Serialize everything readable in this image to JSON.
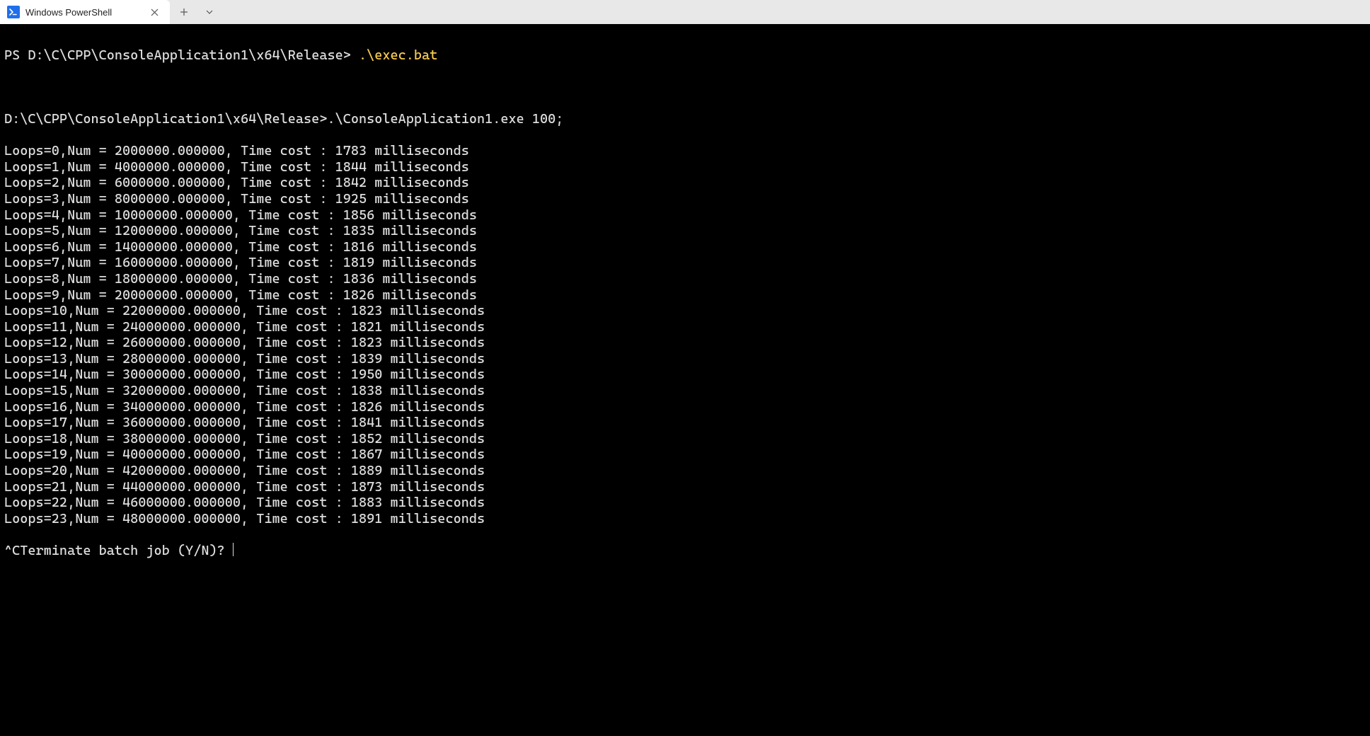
{
  "tab": {
    "title": "Windows PowerShell",
    "icon": "powershell-icon"
  },
  "prompt": {
    "prefix": "PS ",
    "path": "D:\\C\\CPP\\ConsoleApplication1\\x64\\Release>",
    "command": ".\\exec.bat"
  },
  "echo_line": "D:\\C\\CPP\\ConsoleApplication1\\x64\\Release>.\\ConsoleApplication1.exe 100;",
  "output_lines": [
    "Loops=0,Num = 2000000.000000, Time cost : 1783 milliseconds",
    "Loops=1,Num = 4000000.000000, Time cost : 1844 milliseconds",
    "Loops=2,Num = 6000000.000000, Time cost : 1842 milliseconds",
    "Loops=3,Num = 8000000.000000, Time cost : 1925 milliseconds",
    "Loops=4,Num = 10000000.000000, Time cost : 1856 milliseconds",
    "Loops=5,Num = 12000000.000000, Time cost : 1835 milliseconds",
    "Loops=6,Num = 14000000.000000, Time cost : 1816 milliseconds",
    "Loops=7,Num = 16000000.000000, Time cost : 1819 milliseconds",
    "Loops=8,Num = 18000000.000000, Time cost : 1836 milliseconds",
    "Loops=9,Num = 20000000.000000, Time cost : 1826 milliseconds",
    "Loops=10,Num = 22000000.000000, Time cost : 1823 milliseconds",
    "Loops=11,Num = 24000000.000000, Time cost : 1821 milliseconds",
    "Loops=12,Num = 26000000.000000, Time cost : 1823 milliseconds",
    "Loops=13,Num = 28000000.000000, Time cost : 1839 milliseconds",
    "Loops=14,Num = 30000000.000000, Time cost : 1950 milliseconds",
    "Loops=15,Num = 32000000.000000, Time cost : 1838 milliseconds",
    "Loops=16,Num = 34000000.000000, Time cost : 1826 milliseconds",
    "Loops=17,Num = 36000000.000000, Time cost : 1841 milliseconds",
    "Loops=18,Num = 38000000.000000, Time cost : 1852 milliseconds",
    "Loops=19,Num = 40000000.000000, Time cost : 1867 milliseconds",
    "Loops=20,Num = 42000000.000000, Time cost : 1889 milliseconds",
    "Loops=21,Num = 44000000.000000, Time cost : 1873 milliseconds",
    "Loops=22,Num = 46000000.000000, Time cost : 1883 milliseconds",
    "Loops=23,Num = 48000000.000000, Time cost : 1891 milliseconds"
  ],
  "terminate_prompt": "^CTerminate batch job (Y/N)? "
}
